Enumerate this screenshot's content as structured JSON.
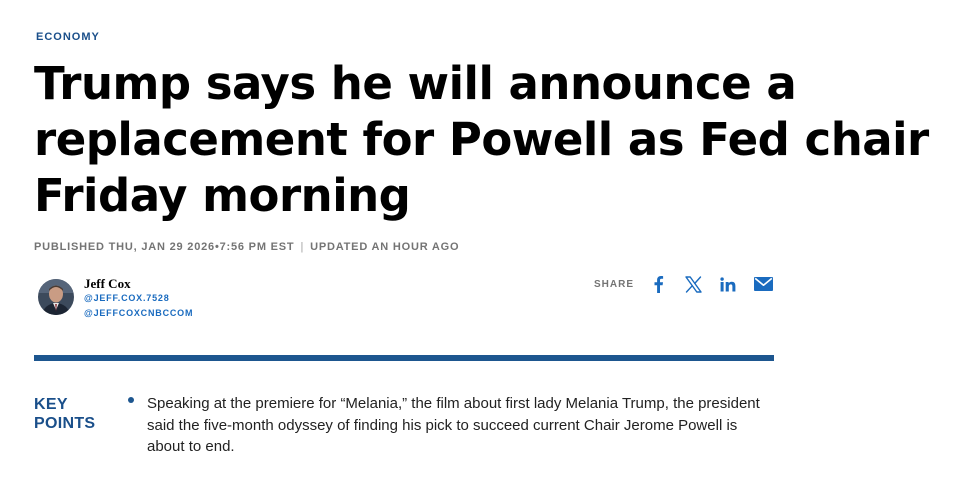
{
  "section": {
    "label": "ECONOMY"
  },
  "article": {
    "headline": "Trump says he will announce a replacement for Powell as Fed chair Friday morning",
    "published": "PUBLISHED THU, JAN 29 2026•7:56 PM EST",
    "separator": "|",
    "updated": "UPDATED AN HOUR AGO"
  },
  "author": {
    "name": "Jeff Cox",
    "handle_primary": "@JEFF.COX.7528",
    "handle_secondary": "@JEFFCOXCNBCCOM"
  },
  "share": {
    "label": "SHARE",
    "icons": [
      "facebook-icon",
      "x-icon",
      "linkedin-icon",
      "email-icon"
    ],
    "icon_color": "#1a6bbf"
  },
  "key_points": {
    "title": "KEY POINTS",
    "items": [
      "Speaking at the premiere for “Melania,” the film about first lady Melania Trump, the president said the five-month odyssey of finding his pick to succeed current Chair Jerome Powell is about to end."
    ]
  },
  "colors": {
    "brand_blue": "#1d568f",
    "link_blue": "#1a6bbf",
    "meta_gray": "#747474",
    "headline_black": "#000000"
  }
}
